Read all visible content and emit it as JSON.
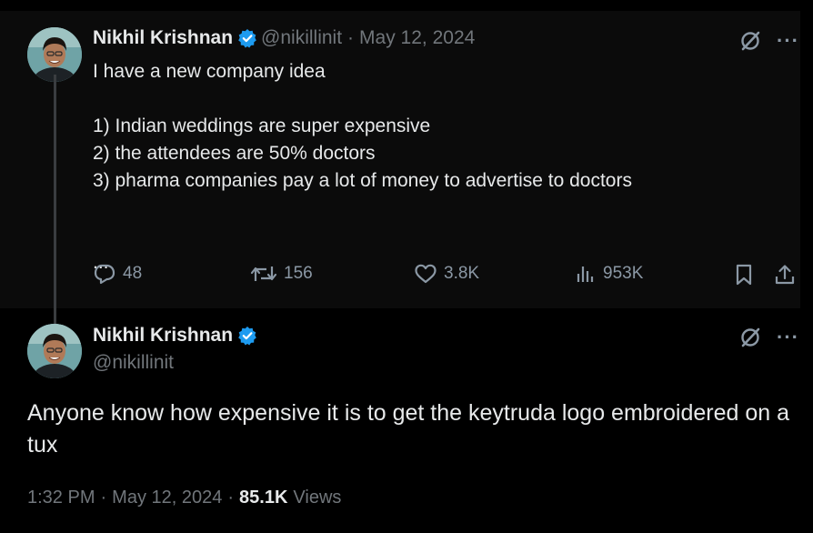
{
  "colors": {
    "background": "#000000",
    "parent_tweet_bg": "#0b0b0b",
    "text_primary": "#e7e9ea",
    "text_secondary": "#71767b",
    "icon": "#8b98a5",
    "verified_badge": "#1d9bf0"
  },
  "parent_tweet": {
    "author": {
      "name": "Nikhil Krishnan",
      "verified": true,
      "handle": "@nikillinit",
      "avatar_icon": "avatar-photo"
    },
    "separator": "·",
    "date": "May 12, 2024",
    "text": "I have a new company idea\n\n1) Indian weddings are super expensive\n2) the attendees are 50% doctors\n3) pharma companies pay a lot of money to advertise to doctors\n\n\n...",
    "top_icons": [
      "grok-icon",
      "more-icon"
    ],
    "more_label": "···",
    "actions": {
      "replies": "48",
      "reposts": "156",
      "likes": "3.8K",
      "views": "953K"
    }
  },
  "main_tweet": {
    "author": {
      "name": "Nikhil Krishnan",
      "verified": true,
      "handle": "@nikillinit",
      "avatar_icon": "avatar-photo"
    },
    "more_label": "···",
    "text": "Anyone know how expensive it is to get the keytruda logo embroidered on a tux",
    "time": "1:32 PM",
    "separator": "·",
    "date": "May 12, 2024",
    "views_count": "85.1K",
    "views_label": "Views"
  }
}
